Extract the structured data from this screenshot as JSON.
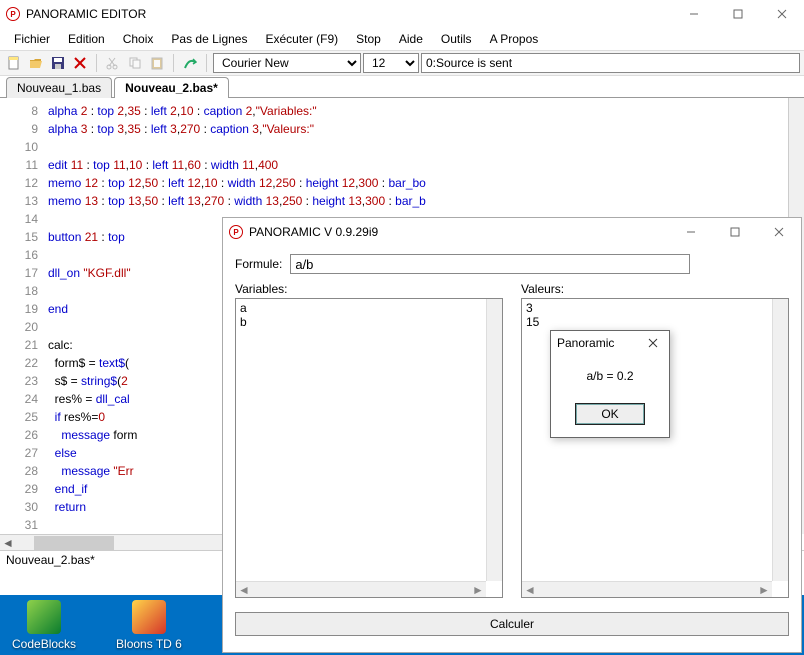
{
  "editor": {
    "title": "PANORAMIC EDITOR",
    "menus": [
      "Fichier",
      "Edition",
      "Choix",
      "Pas de Lignes",
      "Exécuter (F9)",
      "Stop",
      "Aide",
      "Outils",
      "A Propos"
    ],
    "font_name": "Courier New",
    "font_size": "12",
    "status_msg": "0:Source is sent",
    "tabs": [
      {
        "label": "Nouveau_1.bas",
        "active": false
      },
      {
        "label": "Nouveau_2.bas*",
        "active": true
      }
    ],
    "statusbar": "Nouveau_2.bas*",
    "lines": [
      {
        "n": 8,
        "tokens": [
          {
            "t": "alpha ",
            "c": "kw"
          },
          {
            "t": "2",
            "c": "num"
          },
          {
            "t": " : ",
            "c": ""
          },
          {
            "t": "top ",
            "c": "kw"
          },
          {
            "t": "2",
            "c": "num"
          },
          {
            "t": ",",
            "c": ""
          },
          {
            "t": "35",
            "c": "num"
          },
          {
            "t": " : ",
            "c": ""
          },
          {
            "t": "left ",
            "c": "kw"
          },
          {
            "t": "2",
            "c": "num"
          },
          {
            "t": ",",
            "c": ""
          },
          {
            "t": "10",
            "c": "num"
          },
          {
            "t": " : ",
            "c": ""
          },
          {
            "t": "caption ",
            "c": "kw"
          },
          {
            "t": "2",
            "c": "num"
          },
          {
            "t": ",",
            "c": ""
          },
          {
            "t": "\"Variables:\"",
            "c": "str"
          }
        ]
      },
      {
        "n": 9,
        "tokens": [
          {
            "t": "alpha ",
            "c": "kw"
          },
          {
            "t": "3",
            "c": "num"
          },
          {
            "t": " : ",
            "c": ""
          },
          {
            "t": "top ",
            "c": "kw"
          },
          {
            "t": "3",
            "c": "num"
          },
          {
            "t": ",",
            "c": ""
          },
          {
            "t": "35",
            "c": "num"
          },
          {
            "t": " : ",
            "c": ""
          },
          {
            "t": "left ",
            "c": "kw"
          },
          {
            "t": "3",
            "c": "num"
          },
          {
            "t": ",",
            "c": ""
          },
          {
            "t": "270",
            "c": "num"
          },
          {
            "t": " : ",
            "c": ""
          },
          {
            "t": "caption ",
            "c": "kw"
          },
          {
            "t": "3",
            "c": "num"
          },
          {
            "t": ",",
            "c": ""
          },
          {
            "t": "\"Valeurs:\"",
            "c": "str"
          }
        ]
      },
      {
        "n": 10,
        "tokens": []
      },
      {
        "n": 11,
        "tokens": [
          {
            "t": "edit ",
            "c": "kw"
          },
          {
            "t": "11",
            "c": "num"
          },
          {
            "t": " : ",
            "c": ""
          },
          {
            "t": "top ",
            "c": "kw"
          },
          {
            "t": "11",
            "c": "num"
          },
          {
            "t": ",",
            "c": ""
          },
          {
            "t": "10",
            "c": "num"
          },
          {
            "t": " : ",
            "c": ""
          },
          {
            "t": "left ",
            "c": "kw"
          },
          {
            "t": "11",
            "c": "num"
          },
          {
            "t": ",",
            "c": ""
          },
          {
            "t": "60",
            "c": "num"
          },
          {
            "t": " : ",
            "c": ""
          },
          {
            "t": "width ",
            "c": "kw"
          },
          {
            "t": "11",
            "c": "num"
          },
          {
            "t": ",",
            "c": ""
          },
          {
            "t": "400",
            "c": "num"
          }
        ]
      },
      {
        "n": 12,
        "tokens": [
          {
            "t": "memo ",
            "c": "kw"
          },
          {
            "t": "12",
            "c": "num"
          },
          {
            "t": " : ",
            "c": ""
          },
          {
            "t": "top ",
            "c": "kw"
          },
          {
            "t": "12",
            "c": "num"
          },
          {
            "t": ",",
            "c": ""
          },
          {
            "t": "50",
            "c": "num"
          },
          {
            "t": " : ",
            "c": ""
          },
          {
            "t": "left ",
            "c": "kw"
          },
          {
            "t": "12",
            "c": "num"
          },
          {
            "t": ",",
            "c": ""
          },
          {
            "t": "10",
            "c": "num"
          },
          {
            "t": " : ",
            "c": ""
          },
          {
            "t": "width ",
            "c": "kw"
          },
          {
            "t": "12",
            "c": "num"
          },
          {
            "t": ",",
            "c": ""
          },
          {
            "t": "250",
            "c": "num"
          },
          {
            "t": " : ",
            "c": ""
          },
          {
            "t": "height ",
            "c": "kw"
          },
          {
            "t": "12",
            "c": "num"
          },
          {
            "t": ",",
            "c": ""
          },
          {
            "t": "300",
            "c": "num"
          },
          {
            "t": " : ",
            "c": ""
          },
          {
            "t": "bar_bo",
            "c": "kw"
          }
        ]
      },
      {
        "n": 13,
        "tokens": [
          {
            "t": "memo ",
            "c": "kw"
          },
          {
            "t": "13",
            "c": "num"
          },
          {
            "t": " : ",
            "c": ""
          },
          {
            "t": "top ",
            "c": "kw"
          },
          {
            "t": "13",
            "c": "num"
          },
          {
            "t": ",",
            "c": ""
          },
          {
            "t": "50",
            "c": "num"
          },
          {
            "t": " : ",
            "c": ""
          },
          {
            "t": "left ",
            "c": "kw"
          },
          {
            "t": "13",
            "c": "num"
          },
          {
            "t": ",",
            "c": ""
          },
          {
            "t": "270",
            "c": "num"
          },
          {
            "t": " : ",
            "c": ""
          },
          {
            "t": "width ",
            "c": "kw"
          },
          {
            "t": "13",
            "c": "num"
          },
          {
            "t": ",",
            "c": ""
          },
          {
            "t": "250",
            "c": "num"
          },
          {
            "t": " : ",
            "c": ""
          },
          {
            "t": "height ",
            "c": "kw"
          },
          {
            "t": "13",
            "c": "num"
          },
          {
            "t": ",",
            "c": ""
          },
          {
            "t": "300",
            "c": "num"
          },
          {
            "t": " : ",
            "c": ""
          },
          {
            "t": "bar_b",
            "c": "kw"
          }
        ]
      },
      {
        "n": 14,
        "tokens": []
      },
      {
        "n": 15,
        "tokens": [
          {
            "t": "button ",
            "c": "kw"
          },
          {
            "t": "21",
            "c": "num"
          },
          {
            "t": " : ",
            "c": ""
          },
          {
            "t": "top",
            "c": "kw"
          }
        ]
      },
      {
        "n": 16,
        "tokens": []
      },
      {
        "n": 17,
        "tokens": [
          {
            "t": "dll_on ",
            "c": "kw"
          },
          {
            "t": "\"KGF.dll\"",
            "c": "str"
          }
        ]
      },
      {
        "n": 18,
        "tokens": []
      },
      {
        "n": 19,
        "tokens": [
          {
            "t": "end",
            "c": "kw"
          }
        ]
      },
      {
        "n": 20,
        "tokens": []
      },
      {
        "n": 21,
        "tokens": [
          {
            "t": "calc:",
            "c": ""
          }
        ]
      },
      {
        "n": 22,
        "tokens": [
          {
            "t": "  form$ = ",
            "c": ""
          },
          {
            "t": "text$",
            "c": "kw"
          },
          {
            "t": "(",
            "c": ""
          }
        ]
      },
      {
        "n": 23,
        "tokens": [
          {
            "t": "  s$ = ",
            "c": ""
          },
          {
            "t": "string$",
            "c": "kw"
          },
          {
            "t": "(",
            "c": ""
          },
          {
            "t": "2",
            "c": "num"
          }
        ]
      },
      {
        "n": 24,
        "tokens": [
          {
            "t": "  res% = ",
            "c": ""
          },
          {
            "t": "dll_cal",
            "c": "kw"
          }
        ]
      },
      {
        "n": 25,
        "tokens": [
          {
            "t": "  ",
            "c": ""
          },
          {
            "t": "if ",
            "c": "kw"
          },
          {
            "t": "res%=",
            "c": ""
          },
          {
            "t": "0",
            "c": "num"
          }
        ]
      },
      {
        "n": 26,
        "tokens": [
          {
            "t": "    ",
            "c": ""
          },
          {
            "t": "message ",
            "c": "kw"
          },
          {
            "t": "form",
            "c": ""
          }
        ]
      },
      {
        "n": 27,
        "tokens": [
          {
            "t": "  ",
            "c": ""
          },
          {
            "t": "else",
            "c": "kw"
          }
        ]
      },
      {
        "n": 28,
        "tokens": [
          {
            "t": "    ",
            "c": ""
          },
          {
            "t": "message ",
            "c": "kw"
          },
          {
            "t": "\"Err",
            "c": "str"
          }
        ]
      },
      {
        "n": 29,
        "tokens": [
          {
            "t": "  ",
            "c": ""
          },
          {
            "t": "end_if",
            "c": "kw"
          }
        ]
      },
      {
        "n": 30,
        "tokens": [
          {
            "t": "  ",
            "c": ""
          },
          {
            "t": "return",
            "c": "kw"
          }
        ]
      },
      {
        "n": 31,
        "tokens": []
      }
    ]
  },
  "runtime": {
    "title": "PANORAMIC V 0.9.29i9",
    "formule_label": "Formule:",
    "formule_value": "a/b",
    "variables_label": "Variables:",
    "variables_lines": [
      "a",
      "b"
    ],
    "valeurs_label": "Valeurs:",
    "valeurs_lines": [
      "3",
      "15"
    ],
    "calc_button": "Calculer"
  },
  "msgbox": {
    "title": "Panoramic",
    "body": "a/b = 0.2",
    "ok": "OK"
  },
  "desktop": {
    "icons": [
      {
        "label": "CodeBlocks",
        "color1": "#8fd14b",
        "color2": "#0a7c2e"
      },
      {
        "label": "Bloons TD 6",
        "color1": "#ffd54a",
        "color2": "#d4352a"
      }
    ]
  }
}
